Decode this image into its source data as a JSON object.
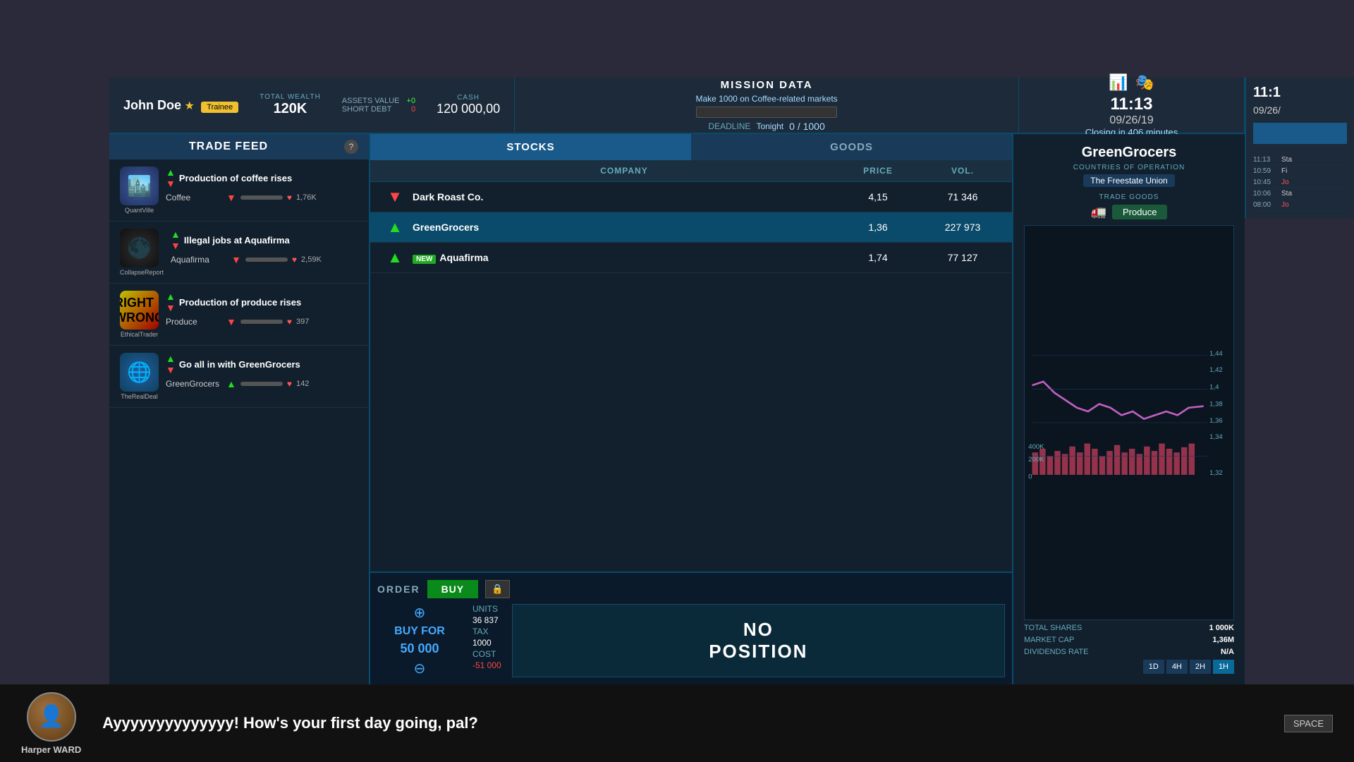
{
  "player": {
    "name": "John Doe",
    "rank": "Trainee",
    "total_wealth_label": "TOTAL WEALTH",
    "total_wealth": "120K",
    "assets_value_label": "ASSETS VALUE",
    "assets_value": "+0",
    "short_debt_label": "SHORT DEBT",
    "short_debt": "0",
    "cash_label": "CASH",
    "cash_value": "120 000,00"
  },
  "mission": {
    "title": "MISSION DATA",
    "description": "Make 1000 on Coffee-related markets",
    "deadline_label": "DEADLINE",
    "deadline": "Tonight",
    "progress": "0 / 1000"
  },
  "clock": {
    "time": "11:13",
    "date": "09/26/19",
    "closing_text": "Closing in 406 minutes"
  },
  "right_clock": {
    "time": "11:1",
    "date": "09/26/"
  },
  "trade_feed": {
    "title": "TRADE FEED",
    "help": "?",
    "items": [
      {
        "source": "QuantVille",
        "headline": "Production of coffee rises",
        "stock": "Coffee",
        "trend": "down",
        "likes": "1,76K",
        "avatar_type": "quantville"
      },
      {
        "source": "CollapseReport",
        "headline": "Illegal jobs at Aquafirma",
        "stock": "Aquafirma",
        "trend": "down",
        "likes": "2,59K",
        "avatar_type": "collapse"
      },
      {
        "source": "EthicalTrader",
        "headline": "Production of produce rises",
        "stock": "Produce",
        "trend": "down",
        "likes": "397",
        "avatar_type": "ethical"
      },
      {
        "source": "TheRealDeal",
        "headline": "Go all in with GreenGrocers",
        "stock": "GreenGrocers",
        "trend": "up",
        "likes": "142",
        "avatar_type": "real"
      }
    ]
  },
  "stocks_tab": {
    "label": "STOCKS",
    "active": true
  },
  "goods_tab": {
    "label": "GOODS",
    "active": false
  },
  "table": {
    "headers": [
      "",
      "COMPANY",
      "PRICE",
      "VOL."
    ],
    "rows": [
      {
        "trend": "down",
        "name": "Dark Roast Co.",
        "price": "4,15",
        "volume": "71 346",
        "selected": false,
        "new_badge": false
      },
      {
        "trend": "up",
        "name": "GreenGrocers",
        "price": "1,36",
        "volume": "227 973",
        "selected": true,
        "new_badge": false
      },
      {
        "trend": "up",
        "name": "Aquafirma",
        "price": "1,74",
        "volume": "77 127",
        "selected": false,
        "new_badge": true
      }
    ]
  },
  "order": {
    "label": "ORDER",
    "buy_label": "BUY",
    "buy_for_label": "BUY FOR",
    "buy_for_amount": "50 000",
    "units_label": "UNITS",
    "units_value": "36 837",
    "tax_label": "TAX",
    "tax_value": "1000",
    "cost_label": "COST",
    "cost_value": "-51 000",
    "no_position": "NO\nPOSITION"
  },
  "company_detail": {
    "name": "GreenGrocers",
    "countries_label": "COUNTRIES OF OPERATION",
    "country": "The Freestate Union",
    "trade_goods_label": "TRADE GOODS",
    "trade_good": "Produce",
    "total_shares_label": "TOTAL SHARES",
    "total_shares": "1 000K",
    "market_cap_label": "MARKET CAP",
    "market_cap": "1,36M",
    "dividends_label": "DIVIDENDS RATE",
    "dividends": "N/A"
  },
  "chart": {
    "y_labels": [
      "1,44",
      "1,42",
      "1,4",
      "1,38",
      "1,36",
      "1,34",
      "1,32"
    ],
    "x_labels": [
      "400K",
      "200K",
      "0"
    ],
    "time_buttons": [
      "1D",
      "4H",
      "2H",
      "1H"
    ],
    "active_time": "1H"
  },
  "right_log": {
    "entries": [
      {
        "time": "11:13",
        "text": "Sta"
      },
      {
        "time": "10:59",
        "text": "Fi"
      },
      {
        "time": "10:45",
        "text": "Jo"
      },
      {
        "time": "10:06",
        "text": "Sta"
      },
      {
        "time": "08:00",
        "text": "Jo"
      }
    ]
  },
  "bottom": {
    "speaker": "Harper WARD",
    "message": "Ayyyyyyyyyyyyyy! How's your first day going, pal?",
    "space_label": "SPACE"
  },
  "icons": {
    "chart_icon": "📊",
    "mask_icon": "🎭",
    "truck_icon": "🚛",
    "heart": "♥",
    "arrow_up": "▲",
    "arrow_down": "▼",
    "lock": "🔒",
    "increment": "⊕",
    "decrement": "⊖"
  }
}
